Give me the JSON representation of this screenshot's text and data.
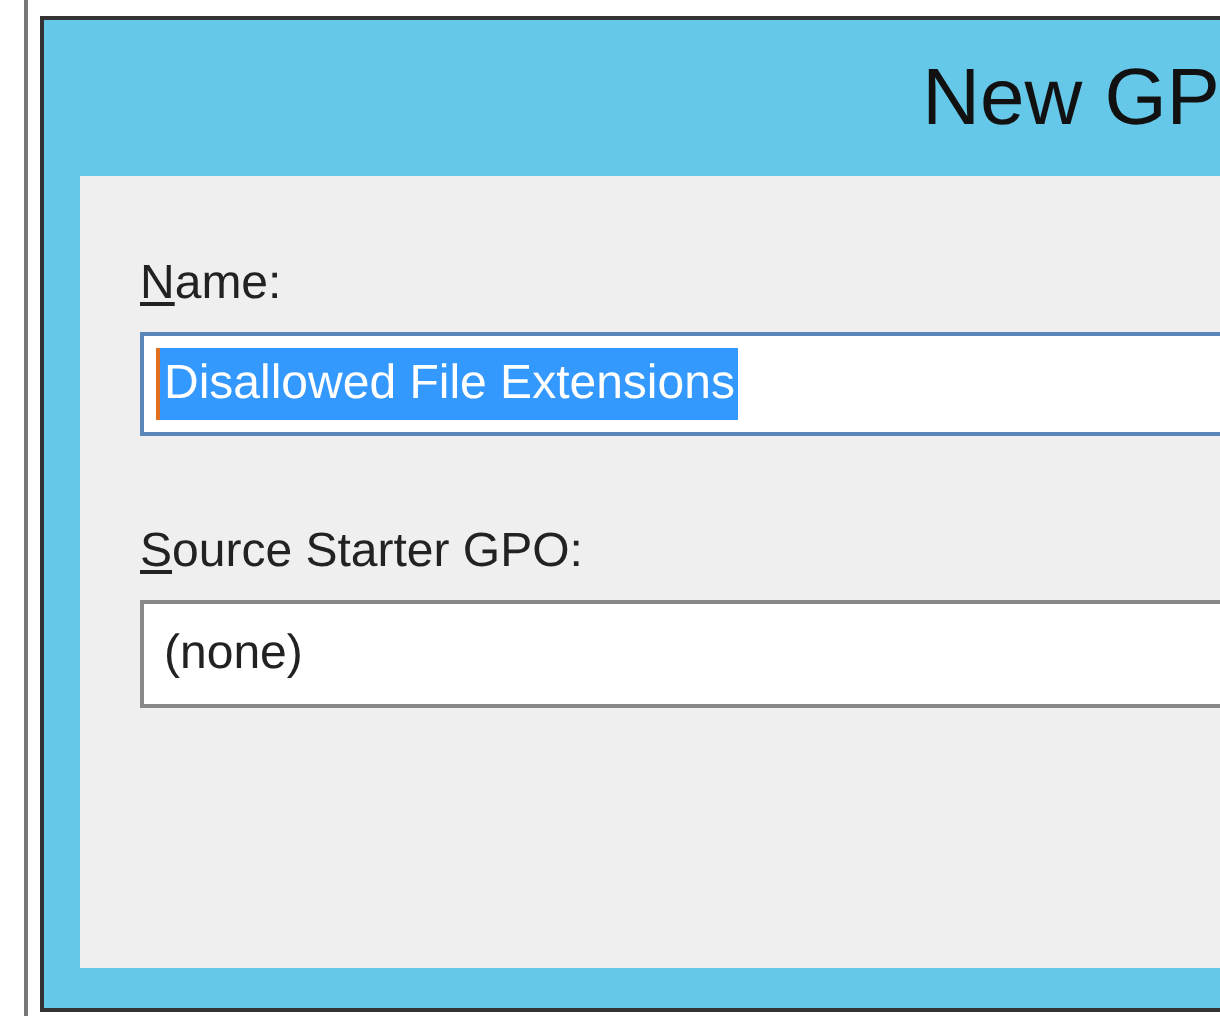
{
  "window": {
    "title": "New GP"
  },
  "name_field": {
    "access_key": "N",
    "label": "ame:",
    "value": "Disallowed File Extensions",
    "text_selected": true
  },
  "source_field": {
    "access_key": "S",
    "label": "ource Starter GPO:",
    "value": "(none)"
  }
}
